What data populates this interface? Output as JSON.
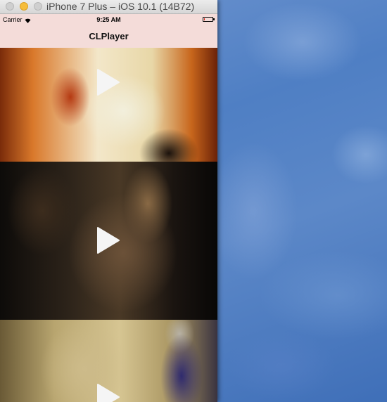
{
  "window": {
    "title": "iPhone 7 Plus – iOS 10.1 (14B72)"
  },
  "status_bar": {
    "carrier": "Carrier",
    "time": "9:25 AM",
    "battery_level": 0.1,
    "battery_color": "#e2231a"
  },
  "nav_bar": {
    "title": "CLPlayer",
    "background": "#f4dcd9"
  },
  "videos": [
    {
      "index": 1,
      "action": "play"
    },
    {
      "index": 2,
      "action": "play"
    },
    {
      "index": 3,
      "action": "play"
    }
  ],
  "icons": {
    "play": "play-icon",
    "wifi": "wifi-icon",
    "battery": "battery-icon"
  }
}
